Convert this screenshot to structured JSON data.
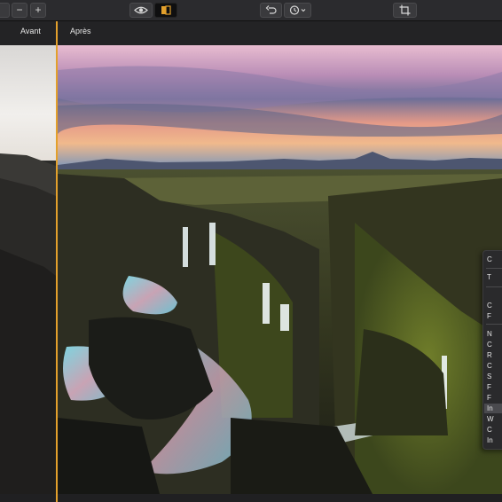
{
  "toolbar": {
    "minus_label": "−",
    "plus_label": "+",
    "icons": [
      "eye-icon",
      "compare-split-icon",
      "undo-icon",
      "history-clock-icon",
      "crop-icon"
    ]
  },
  "compare": {
    "before_label": "Avant",
    "after_label": "Après"
  },
  "context_menu": {
    "items": [
      "C",
      "T",
      "C",
      "F",
      "N",
      "C",
      "R",
      "C",
      "S",
      "F",
      "F",
      "In",
      "W",
      "C",
      "In"
    ]
  },
  "colors": {
    "accent": "#e3a02c",
    "toolbar_bg": "#2b2b2e",
    "app_bg": "#1c1c1e"
  }
}
